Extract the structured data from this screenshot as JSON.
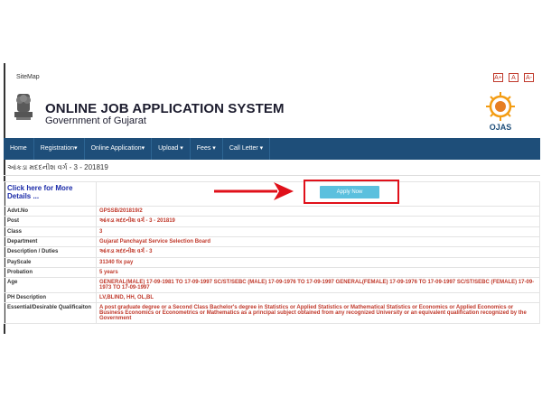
{
  "top": {
    "sitemap": "SiteMap",
    "font_buttons": [
      "A+",
      "A",
      "A-"
    ]
  },
  "header": {
    "title": "ONLINE JOB APPLICATION SYSTEM",
    "subtitle": "Government of Gujarat",
    "emblem_caption": "सत्यमेव जयते",
    "logo_text": "OJAS"
  },
  "nav": {
    "items": [
      {
        "label": "Home"
      },
      {
        "label": "Registration▾"
      },
      {
        "label": "Online Application▾"
      },
      {
        "label": "Upload ▾"
      },
      {
        "label": "Fees ▾"
      },
      {
        "label": "Call Letter ▾"
      }
    ]
  },
  "page": {
    "breadcrumb": "આંકડા મદદનીશ વર્ગ - 3 - 201819"
  },
  "details": {
    "more_link": "Click here for More Details ...",
    "apply_label": "Apply Now",
    "rows": [
      {
        "label": "Advt.No",
        "value": "GPSSB/201819/2"
      },
      {
        "label": "Post",
        "value": "આંકડા મદદનીશ વર્ગ - 3 - 201819"
      },
      {
        "label": "Class",
        "value": "3"
      },
      {
        "label": "Department",
        "value": "Gujarat Panchayat Service Selection Board"
      },
      {
        "label": "Description / Duties",
        "value": "આંકડા મદદનીશ વર્ગ - 3"
      },
      {
        "label": "PayScale",
        "value": "31340 fix pay"
      },
      {
        "label": "Probation",
        "value": "5 years"
      },
      {
        "label": "Age",
        "value": "GENERAL(MALE) 17-09-1981 TO 17-09-1997 SC/ST/SEBC (MALE) 17-09-1976 TO 17-09-1997 GENERAL(FEMALE) 17-09-1976 TO 17-09-1997 SC/ST/SEBC (FEMALE) 17-09-1973 TO 17-09-1997"
      },
      {
        "label": "PH Description",
        "value": "LV,BLIND, HH, OL,BL"
      },
      {
        "label": "Essential/Desirable Qualificaiton",
        "value": "A post graduate degree or a Second Class Bachelor's degree in Statistics or Applied Statistics or Mathematical Statistics or Economics or Applied Economics or Business Economics or Econometrics or Mathematics as a principal subject obtained from any recognized University or an equivalent qualification recognized by the Government"
      }
    ]
  },
  "colors": {
    "nav_bg": "#1e4e79",
    "value_text": "#c0392b",
    "apply_btn": "#5bc0de",
    "highlight": "#e0101a"
  }
}
